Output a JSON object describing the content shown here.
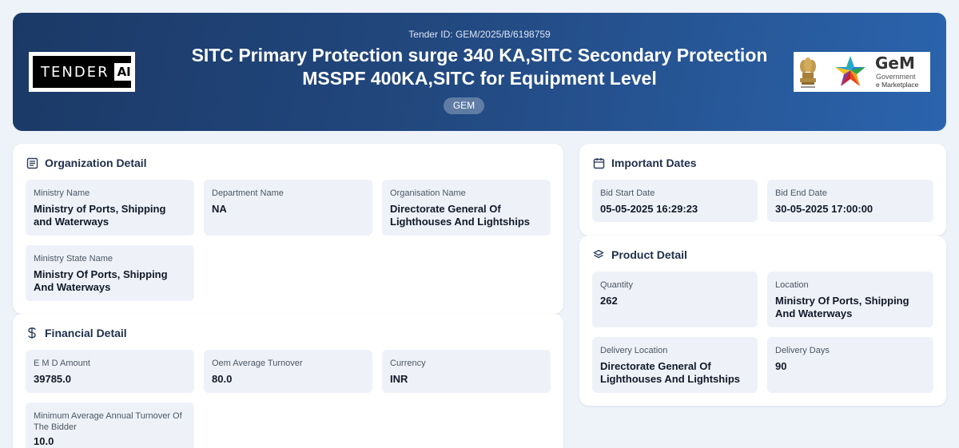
{
  "header": {
    "tender_id": "Tender ID: GEM/2025/B/6198759",
    "title": "SITC Primary Protection surge 340 KA,SITC Secondary Protection MSSPF 400KA,SITC for Equipment Level",
    "badge": "GEM",
    "logo_left": {
      "text": "TENDER",
      "highlight": "AI"
    },
    "logo_right": {
      "text": "GeM",
      "sub1": "Government",
      "sub2": "e Marketplace"
    }
  },
  "organization": {
    "title": "Organization Detail",
    "icon": "document-icon",
    "fields": [
      {
        "label": "Ministry Name",
        "value": "Ministry of Ports, Shipping and Waterways"
      },
      {
        "label": "Department Name",
        "value": "NA"
      },
      {
        "label": "Organisation Name",
        "value": "Directorate General Of Lighthouses And Lightships"
      },
      {
        "label": "Ministry State Name",
        "value": "Ministry Of Ports, Shipping And Waterways"
      }
    ]
  },
  "financial": {
    "title": "Financial Detail",
    "icon": "dollar-icon",
    "fields": [
      {
        "label": "E M D Amount",
        "value": "39785.0"
      },
      {
        "label": "Oem Average Turnover",
        "value": "80.0"
      },
      {
        "label": "Currency",
        "value": "INR"
      },
      {
        "label": "Minimum Average Annual Turnover Of The Bidder",
        "value": "10.0"
      }
    ]
  },
  "dates": {
    "title": "Important Dates",
    "icon": "calendar-icon",
    "fields": [
      {
        "label": "Bid Start Date",
        "value": "05-05-2025 16:29:23"
      },
      {
        "label": "Bid End Date",
        "value": "30-05-2025 17:00:00"
      }
    ]
  },
  "product": {
    "title": "Product Detail",
    "icon": "layers-icon",
    "fields": [
      {
        "label": "Quantity",
        "value": "262"
      },
      {
        "label": "Location",
        "value": "Ministry Of Ports, Shipping And Waterways"
      },
      {
        "label": "Delivery Location",
        "value": "Directorate General Of Lighthouses And Lightships"
      },
      {
        "label": "Delivery Days",
        "value": "90"
      }
    ]
  },
  "colors": {
    "hero_start": "#1b3966",
    "hero_end": "#2b64ad",
    "field_bg": "#eef2f8",
    "page_bg": "#eef2f9"
  }
}
